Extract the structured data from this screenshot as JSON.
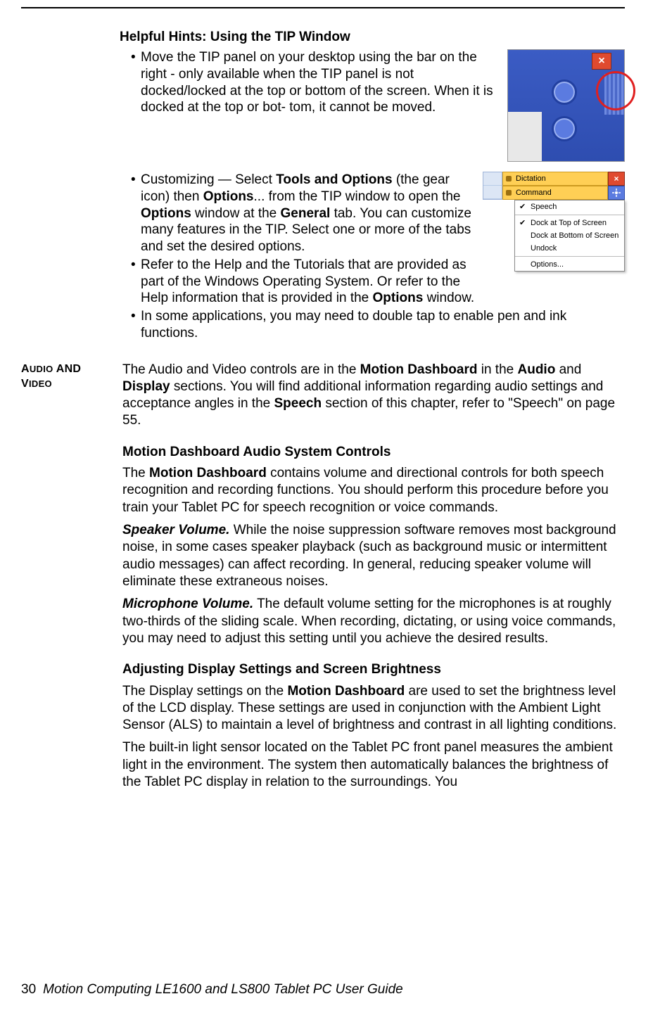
{
  "headings": {
    "helpful_hints": "Helpful Hints: Using the TIP Window",
    "motion_dashboard_audio": "Motion Dashboard Audio System Controls",
    "adjusting_display": "Adjusting Display Settings and Screen Brightness"
  },
  "side_label": {
    "line1_prefix": "A",
    "line1_rest": "UDIO",
    "line1_and": " AND",
    "line1_and_prefix": "AND",
    "line2_prefix": "V",
    "line2_rest": "IDEO"
  },
  "bullets": {
    "b1": "Move the TIP panel on your desktop using the bar on the right - only available when the TIP panel is not docked/locked at the top or bottom of the screen. When it is docked at the top or bot- tom, it cannot be moved.",
    "b2_pre": "Customizing — Select ",
    "b2_bold1": "Tools and Options",
    "b2_mid1": " (the gear icon) then ",
    "b2_bold2": "Options",
    "b2_mid2": "... from the TIP window to open the ",
    "b2_bold3": "Options",
    "b2_mid3": " window at the ",
    "b2_bold4": "General",
    "b2_mid4": " tab. You can customize many features in the TIP. Select one or more of the tabs and set the desired options.",
    "b3_pre": "Refer to the Help and the Tutorials that are provided as part of the Windows Operating System. Or refer to the Help information that is provided in the ",
    "b3_bold": "Options",
    "b3_post": " window.",
    "b4": "In some applications, you may need to double tap to enable pen and ink functions."
  },
  "audio_video_intro": {
    "pre": "The Audio and Video controls are in the ",
    "bold1": "Motion Dashboard",
    "mid1": " in the ",
    "bold2": "Audio",
    "mid2": " and ",
    "bold3": "Display",
    "mid3": " sections. You will find additional information regarding audio settings and acceptance angles in the ",
    "bold4": "Speech",
    "post": " section of this chapter, refer to \"Speech\" on page 55."
  },
  "motion_dashboard_para": {
    "pre": "The ",
    "bold": "Motion Dashboard",
    "post": " contains volume and directional controls for both speech recognition and recording functions. You should perform this procedure before you train your Tablet PC for speech recognition or voice commands."
  },
  "speaker_volume": {
    "label": "Speaker Volume.",
    "text": " While the noise suppression software removes most background noise, in some cases speaker playback (such as background music or intermittent audio messages) can affect recording. In general, reducing speaker volume will eliminate these extraneous noises."
  },
  "mic_volume": {
    "label": "Microphone Volume.",
    "text": " The default volume setting for the microphones is at roughly two-thirds of the sliding scale. When recording, dictating, or using voice commands, you may need to adjust this setting until you achieve the desired results."
  },
  "display_p1": {
    "pre": "The Display settings on the ",
    "bold": "Motion Dashboard",
    "post": " are used to set the brightness level of the LCD display. These settings are used in conjunction with the Ambient Light Sensor (ALS) to maintain a level of brightness and contrast in all lighting conditions."
  },
  "display_p2": "The built-in light sensor located on the Tablet PC front panel measures the ambient light in the environment. The system then automatically balances the brightness of the Tablet PC display in relation to the surroundings. You",
  "figure2": {
    "dictation": "Dictation",
    "command": "Command",
    "speech": "Speech",
    "dock_top": "Dock at Top of Screen",
    "dock_bottom": "Dock at Bottom of Screen",
    "undock": "Undock",
    "options": "Options..."
  },
  "footer": {
    "page_number": "30",
    "title": "Motion Computing LE1600 and LS800 Tablet PC User Guide"
  }
}
